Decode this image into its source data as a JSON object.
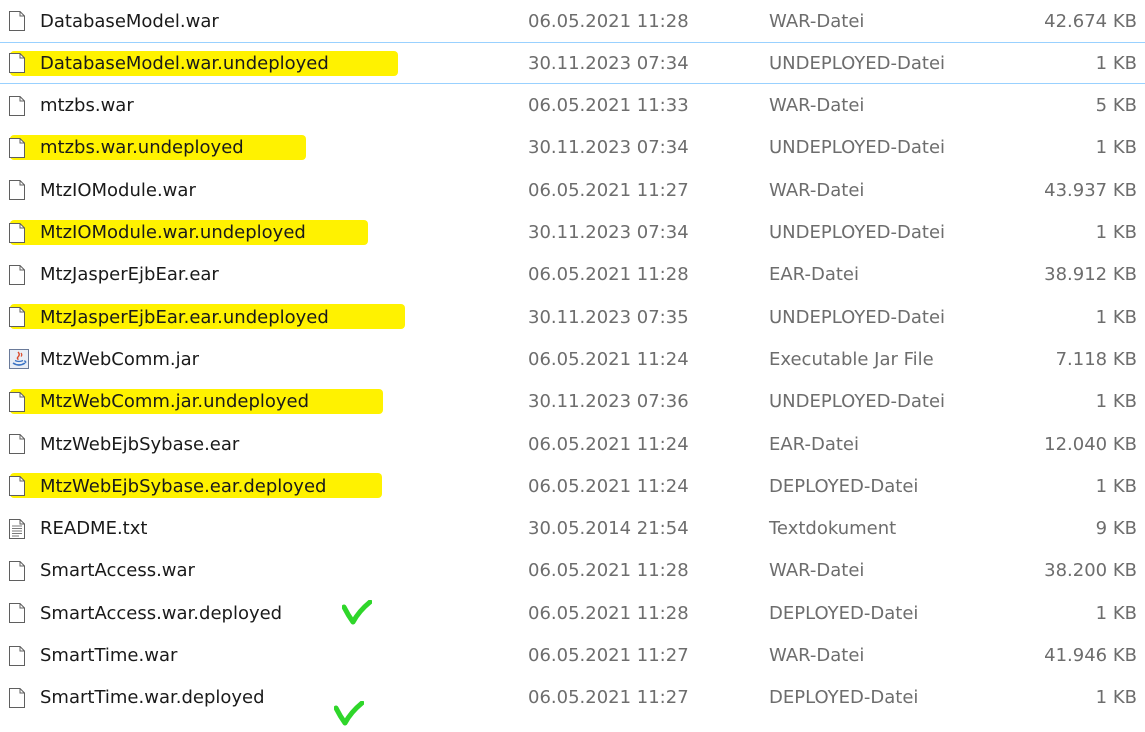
{
  "accent_colors": {
    "highlight": "#fff200",
    "check": "#2fd62a",
    "selection_border": "#99d1ff"
  },
  "files": [
    {
      "name": "DatabaseModel.war",
      "date": "06.05.2021 11:28",
      "type": "WAR-Datei",
      "size": "42.674 KB",
      "icon": "file-icon",
      "highlighted": false
    },
    {
      "name": "DatabaseModel.war.undeployed",
      "date": "30.11.2023 07:34",
      "type": "UNDEPLOYED-Datei",
      "size": "1 KB",
      "icon": "file-icon",
      "highlighted": true,
      "selected": true
    },
    {
      "name": "mtzbs.war",
      "date": "06.05.2021 11:33",
      "type": "WAR-Datei",
      "size": "5 KB",
      "icon": "file-icon",
      "highlighted": false
    },
    {
      "name": "mtzbs.war.undeployed",
      "date": "30.11.2023 07:34",
      "type": "UNDEPLOYED-Datei",
      "size": "1 KB",
      "icon": "file-icon",
      "highlighted": true
    },
    {
      "name": "MtzIOModule.war",
      "date": "06.05.2021 11:27",
      "type": "WAR-Datei",
      "size": "43.937 KB",
      "icon": "file-icon",
      "highlighted": false
    },
    {
      "name": "MtzIOModule.war.undeployed",
      "date": "30.11.2023 07:34",
      "type": "UNDEPLOYED-Datei",
      "size": "1 KB",
      "icon": "file-icon",
      "highlighted": true
    },
    {
      "name": "MtzJasperEjbEar.ear",
      "date": "06.05.2021 11:28",
      "type": "EAR-Datei",
      "size": "38.912 KB",
      "icon": "file-icon",
      "highlighted": false
    },
    {
      "name": "MtzJasperEjbEar.ear.undeployed",
      "date": "30.11.2023 07:35",
      "type": "UNDEPLOYED-Datei",
      "size": "1 KB",
      "icon": "file-icon",
      "highlighted": true
    },
    {
      "name": "MtzWebComm.jar",
      "date": "06.05.2021 11:24",
      "type": "Executable Jar File",
      "size": "7.118 KB",
      "icon": "java-jar-icon",
      "highlighted": false
    },
    {
      "name": "MtzWebComm.jar.undeployed",
      "date": "30.11.2023 07:36",
      "type": "UNDEPLOYED-Datei",
      "size": "1 KB",
      "icon": "file-icon",
      "highlighted": true
    },
    {
      "name": "MtzWebEjbSybase.ear",
      "date": "06.05.2021 11:24",
      "type": "EAR-Datei",
      "size": "12.040 KB",
      "icon": "file-icon",
      "highlighted": false
    },
    {
      "name": "MtzWebEjbSybase.ear.deployed",
      "date": "06.05.2021 11:24",
      "type": "DEPLOYED-Datei",
      "size": "1 KB",
      "icon": "file-icon",
      "highlighted": true
    },
    {
      "name": "README.txt",
      "date": "30.05.2014 21:54",
      "type": "Textdokument",
      "size": "9 KB",
      "icon": "text-file-icon",
      "highlighted": false
    },
    {
      "name": "SmartAccess.war",
      "date": "06.05.2021 11:28",
      "type": "WAR-Datei",
      "size": "38.200 KB",
      "icon": "file-icon",
      "highlighted": false
    },
    {
      "name": "SmartAccess.war.deployed",
      "date": "06.05.2021 11:28",
      "type": "DEPLOYED-Datei",
      "size": "1 KB",
      "icon": "file-icon",
      "highlighted": false,
      "checkmark": true
    },
    {
      "name": "SmartTime.war",
      "date": "06.05.2021 11:27",
      "type": "WAR-Datei",
      "size": "41.946 KB",
      "icon": "file-icon",
      "highlighted": false
    },
    {
      "name": "SmartTime.war.deployed",
      "date": "06.05.2021 11:27",
      "type": "DEPLOYED-Datei",
      "size": "1 KB",
      "icon": "file-icon",
      "highlighted": false,
      "checkmark": true
    }
  ]
}
